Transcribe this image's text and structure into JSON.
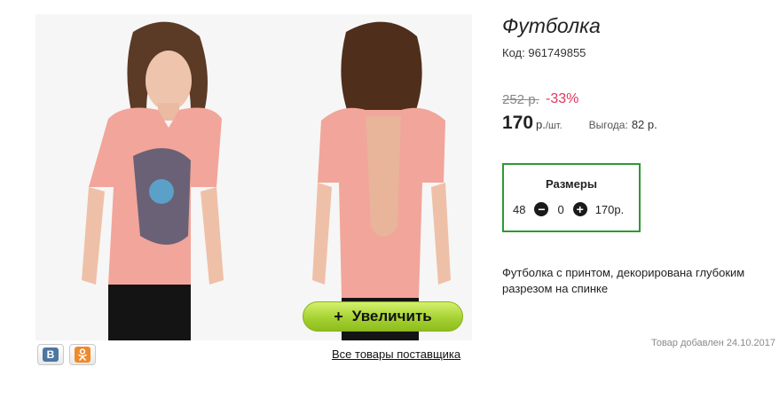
{
  "product": {
    "title": "Футболка",
    "code_label": "Код:",
    "code_value": "961749855",
    "old_price": "252 р.",
    "discount": "-33%",
    "price": "170",
    "price_unit": "р.",
    "price_per": "/шт.",
    "benefit_label": "Выгода:",
    "benefit_value": "82 р.",
    "description": "Футболка с принтом, декорирована глубоким разрезом на спинке",
    "added": "Товар добавлен 24.10.2017"
  },
  "sizes": {
    "title": "Размеры",
    "size": "48",
    "quantity": "0",
    "price": "170р.",
    "minus_glyph": "−",
    "plus_glyph": "+"
  },
  "gallery": {
    "zoom_plus": "+",
    "zoom_label": "Увеличить",
    "supplier_link": "Все товары поставщика"
  },
  "social": {
    "vk_glyph": "В",
    "vk_icon": "vk-icon",
    "ok_icon": "odnoklassniki-icon"
  },
  "colors": {
    "accent_green": "#2f9a2f",
    "discount_red": "#e0355d",
    "button_green": "#a6d232"
  }
}
